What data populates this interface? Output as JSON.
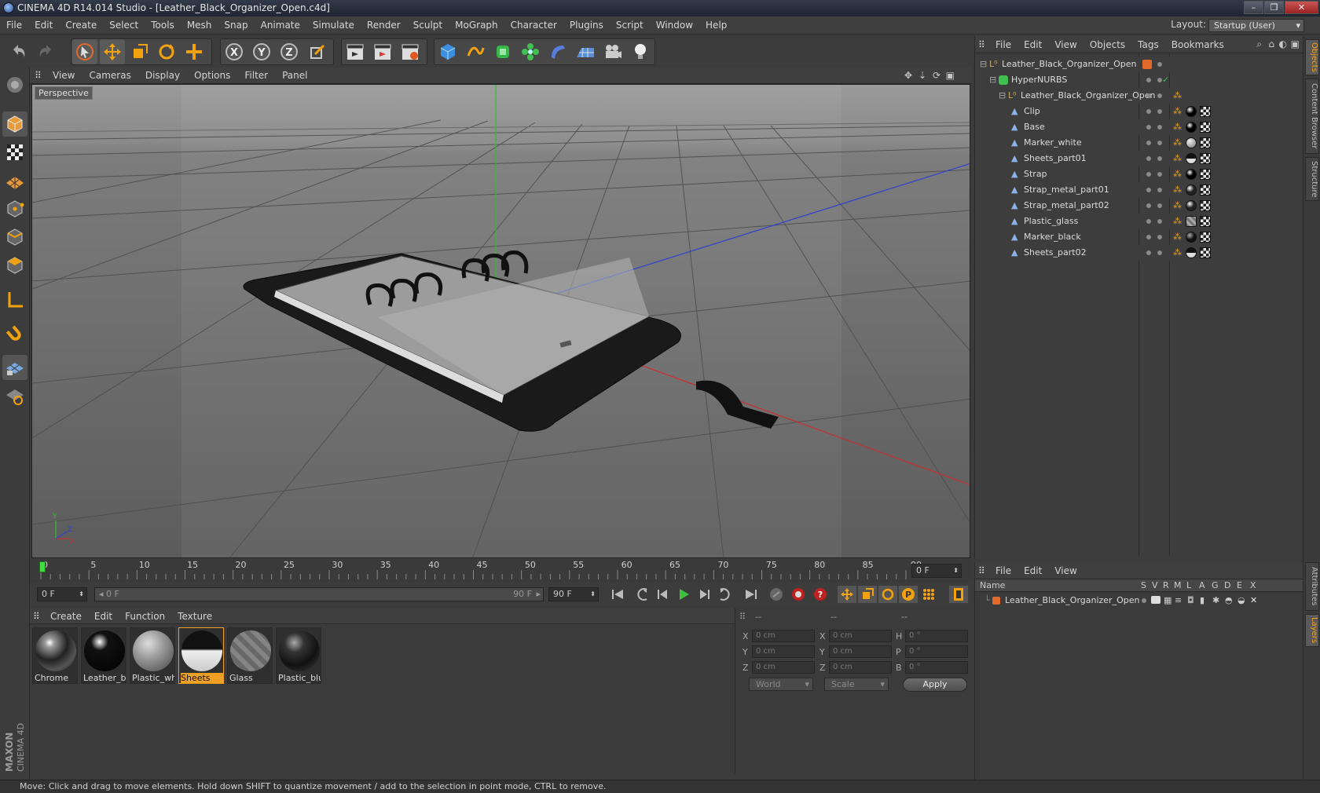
{
  "window": {
    "title": "CINEMA 4D R14.014 Studio - [Leather_Black_Organizer_Open.c4d]",
    "minimize": "–",
    "maximize": "❐",
    "close": "✕"
  },
  "menubar": [
    "File",
    "Edit",
    "Create",
    "Select",
    "Tools",
    "Mesh",
    "Snap",
    "Animate",
    "Simulate",
    "Render",
    "Sculpt",
    "MoGraph",
    "Character",
    "Plugins",
    "Script",
    "Window",
    "Help"
  ],
  "layout": {
    "label": "Layout:",
    "value": "Startup (User)"
  },
  "viewport": {
    "menu": [
      "View",
      "Cameras",
      "Display",
      "Options",
      "Filter",
      "Panel"
    ],
    "camera_label": "Perspective",
    "axis": {
      "y": "Y",
      "z": "Z",
      "x": "X"
    }
  },
  "timeline": {
    "ticks": [
      "0",
      "5",
      "10",
      "15",
      "20",
      "25",
      "30",
      "35",
      "40",
      "45",
      "50",
      "55",
      "60",
      "65",
      "70",
      "75",
      "80",
      "85",
      "90"
    ],
    "current_frame": "0 F",
    "start_field": "0 F",
    "range_start": "0 F",
    "range_end": "90 F",
    "end_field": "90 F"
  },
  "materials": {
    "menu": [
      "Create",
      "Edit",
      "Function",
      "Texture"
    ],
    "items": [
      {
        "label": "Chrome"
      },
      {
        "label": "Leather_bla"
      },
      {
        "label": "Plastic_whi"
      },
      {
        "label": "Sheets"
      },
      {
        "label": "Glass"
      },
      {
        "label": "Plastic_blu"
      }
    ],
    "selected": "Sheets"
  },
  "coordinates": {
    "header": [
      "--",
      "--",
      "--"
    ],
    "rows": [
      {
        "l1": "X",
        "v1": "0 cm",
        "l2": "X",
        "v2": "0 cm",
        "l3": "H",
        "v3": "0 °"
      },
      {
        "l1": "Y",
        "v1": "0 cm",
        "l2": "Y",
        "v2": "0 cm",
        "l3": "P",
        "v3": "0 °"
      },
      {
        "l1": "Z",
        "v1": "0 cm",
        "l2": "Z",
        "v2": "0 cm",
        "l3": "B",
        "v3": "0 °"
      }
    ],
    "mode": "World",
    "size_mode": "Scale",
    "apply": "Apply"
  },
  "objects": {
    "menu": [
      "File",
      "Edit",
      "View",
      "Objects",
      "Tags",
      "Bookmarks"
    ],
    "tree": [
      {
        "name": "Leather_Black_Organizer_Open"
      },
      {
        "name": "HyperNURBS"
      },
      {
        "name": "Leather_Black_Organizer_Open"
      },
      {
        "name": "Clip"
      },
      {
        "name": "Base"
      },
      {
        "name": "Marker_white"
      },
      {
        "name": "Sheets_part01"
      },
      {
        "name": "Strap"
      },
      {
        "name": "Strap_metal_part01"
      },
      {
        "name": "Strap_metal_part02"
      },
      {
        "name": "Plastic_glass"
      },
      {
        "name": "Marker_black"
      },
      {
        "name": "Sheets_part02"
      }
    ]
  },
  "layers": {
    "menu": [
      "File",
      "Edit",
      "View"
    ],
    "columns": [
      "Name",
      "S",
      "V",
      "R",
      "M",
      "L",
      "A",
      "G",
      "D",
      "E",
      "X"
    ],
    "rows": [
      {
        "name": "Leather_Black_Organizer_Open"
      }
    ]
  },
  "side_tabs": [
    "Objects",
    "Content Browser",
    "Structure",
    "Attributes",
    "Layers"
  ],
  "status": "Move: Click and drag to move elements. Hold down SHIFT to quantize movement / add to the selection in point mode, CTRL to remove.",
  "brand": "MAXON CINEMA 4D",
  "colors": {
    "accent": "#f0a020",
    "x_axis": "#c83030",
    "y_axis": "#30c030",
    "z_axis": "#3040d0"
  }
}
